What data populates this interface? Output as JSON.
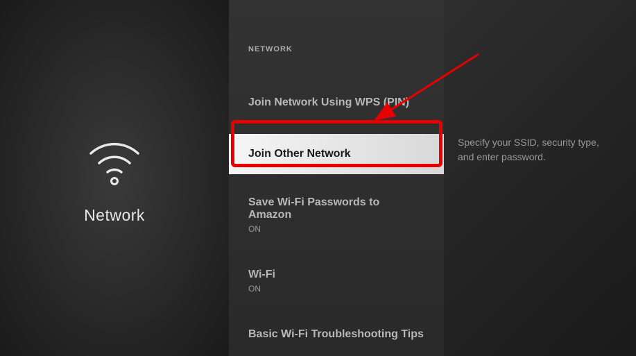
{
  "left": {
    "label": "Network"
  },
  "header": "NETWORK",
  "menu": {
    "item0": {
      "label": "Join Network Using WPS (PIN)"
    },
    "item1": {
      "label": "Join Other Network"
    },
    "item2": {
      "label": "Save Wi-Fi Passwords to Amazon",
      "status": "ON"
    },
    "item3": {
      "label": "Wi-Fi",
      "status": "ON"
    },
    "item4": {
      "label": "Basic Wi-Fi Troubleshooting Tips"
    }
  },
  "help": {
    "text": "Specify your SSID, security type, and enter password."
  },
  "annotation": {
    "color": "#e60000"
  }
}
